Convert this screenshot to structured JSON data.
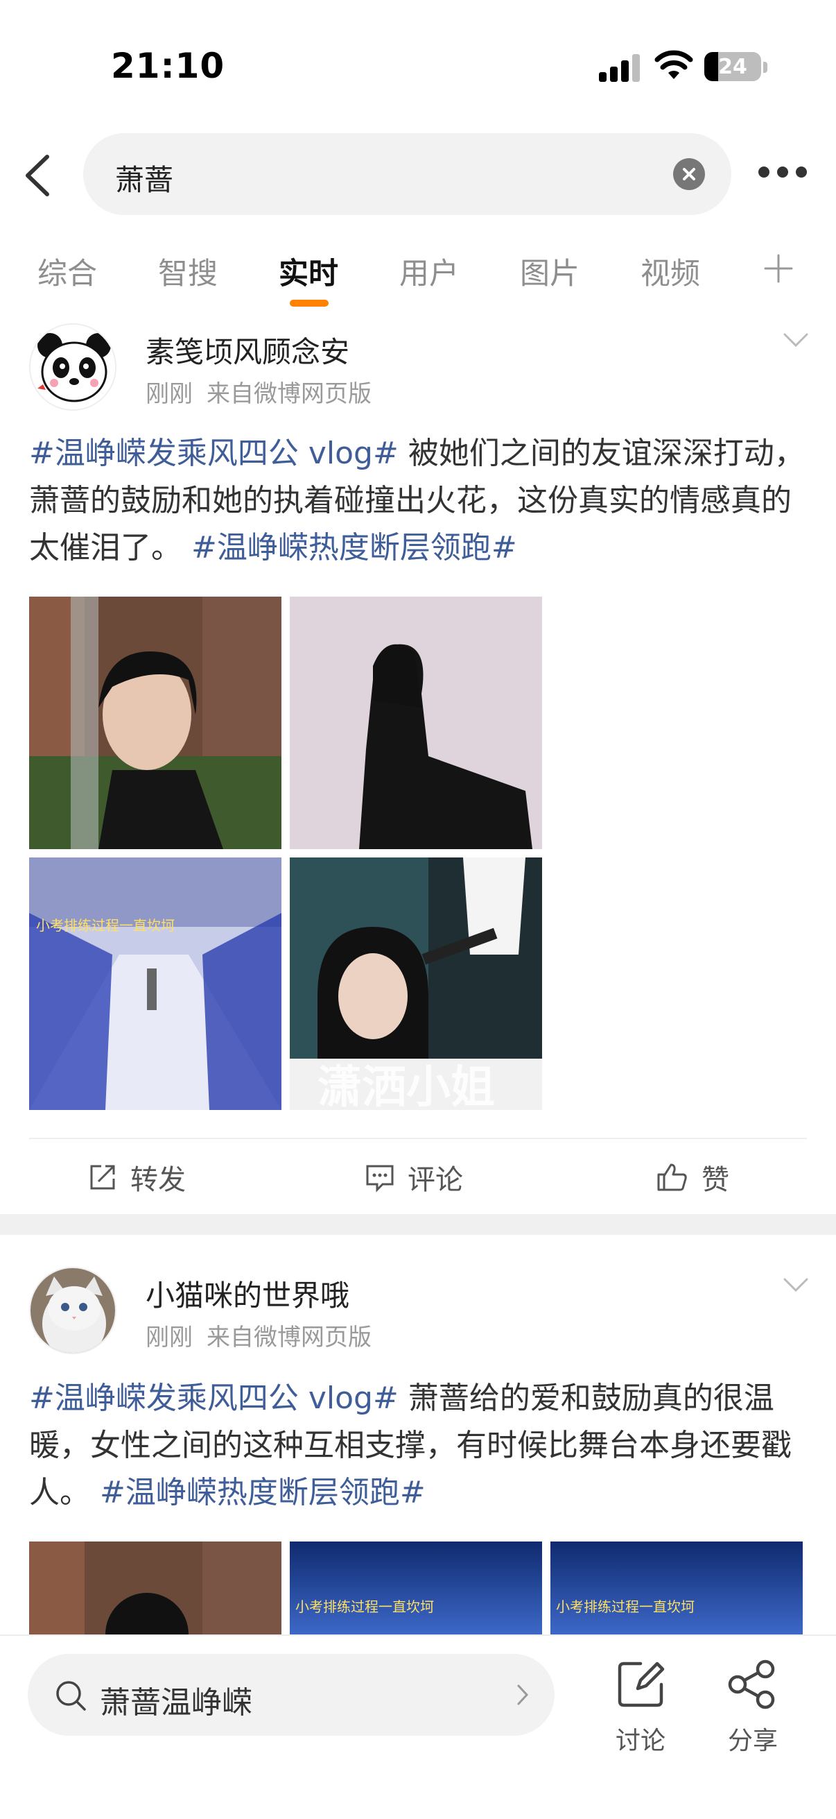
{
  "status_bar": {
    "time": "21:10",
    "battery": "24"
  },
  "search": {
    "query": "萧蔷"
  },
  "tabs": [
    {
      "label": "综合"
    },
    {
      "label": "智搜"
    },
    {
      "label": "实时"
    },
    {
      "label": "用户"
    },
    {
      "label": "图片"
    },
    {
      "label": "视频"
    }
  ],
  "active_tab": "实时",
  "accent_color": "#ff8200",
  "posts": [
    {
      "username": "素笺顷风顾念安",
      "time": "刚刚",
      "source": "来自微博网页版",
      "text_parts": {
        "tag1": "#温峥嵘发乘风四公 vlog#",
        "body": " 被她们之间的友谊深深打动，萧蔷的鼓励和她的执着碰撞出火花，这份真实的情感真的太催泪了。 ",
        "tag2": "#温峥嵘热度断层领跑#"
      },
      "image_captions": [
        "小考排练过程一直坎坷",
        "潇洒小姐"
      ]
    },
    {
      "username": "小猫咪的世界哦",
      "time": "刚刚",
      "source": "来自微博网页版",
      "text_parts": {
        "tag1": "#温峥嵘发乘风四公 vlog#",
        "body": " 萧蔷给的爱和鼓励真的很温暖，女性之间的这种互相支撑，有时候比舞台本身还要戳人。 ",
        "tag2": "#温峥嵘热度断层领跑#"
      },
      "image_captions": [
        "小考排练过程一直坎坷",
        "小考排练过程一直坎坷"
      ]
    }
  ],
  "actions": {
    "repost": "转发",
    "comment": "评论",
    "like": "赞"
  },
  "bottom": {
    "search_text": "萧蔷温峥嵘",
    "discuss": "讨论",
    "share": "分享"
  },
  "icons": [
    "back-arrow-icon",
    "clear-icon",
    "more-icon",
    "plus-icon",
    "chevron-down-icon",
    "repost-icon",
    "comment-icon",
    "like-icon",
    "search-icon",
    "chevron-right-icon",
    "edit-icon",
    "share-icon"
  ]
}
